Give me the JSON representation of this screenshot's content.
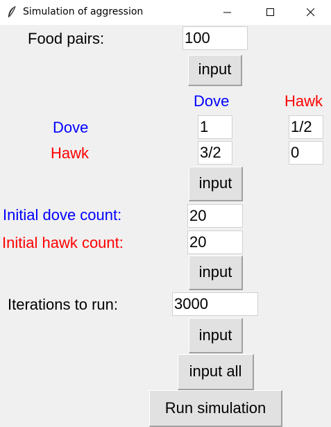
{
  "window": {
    "title": "Simulation of aggression",
    "icon": "feather-icon",
    "controls": [
      "minimize-icon",
      "maximize-icon",
      "close-icon"
    ]
  },
  "food_pairs": {
    "label": "Food pairs:",
    "value": "100",
    "button": "input"
  },
  "payoff": {
    "col_dove": "Dove",
    "col_hawk": "Hawk",
    "row_dove": "Dove",
    "row_hawk": "Hawk",
    "dove_dove": "1",
    "dove_hawk": "1/2",
    "hawk_dove": "3/2",
    "hawk_hawk": "0",
    "button": "input"
  },
  "initial": {
    "dove_label": "Initial dove count:",
    "dove_value": "20",
    "hawk_label": "Initial hawk count:",
    "hawk_value": "20",
    "button": "input"
  },
  "iterations": {
    "label": "Iterations to run:",
    "value": "3000",
    "button": "input"
  },
  "actions": {
    "input_all": "input all",
    "run": "Run simulation"
  },
  "colors": {
    "dove": "#0000ff",
    "hawk": "#ff0000",
    "background": "#f0f0f0"
  }
}
